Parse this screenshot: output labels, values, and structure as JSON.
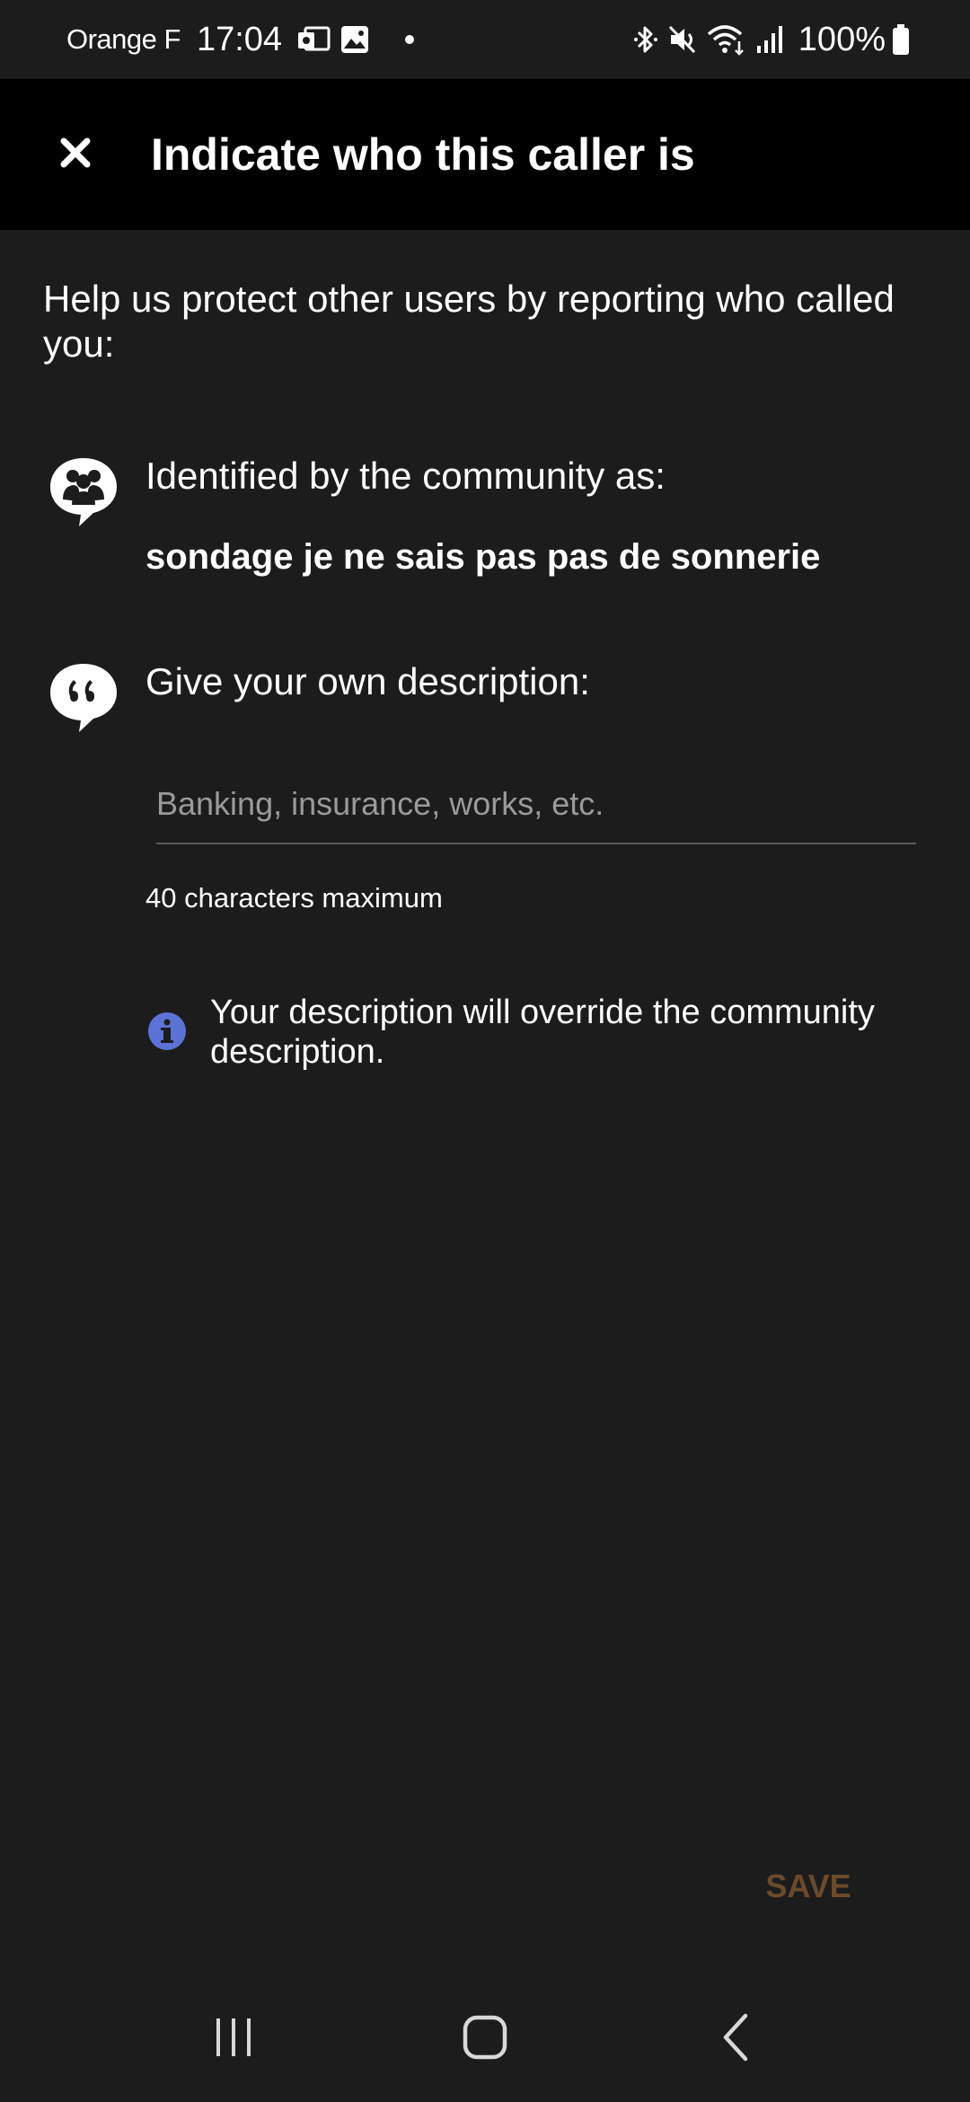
{
  "status_bar": {
    "carrier": "Orange F",
    "time": "17:04",
    "battery": "100%",
    "icons_left": [
      "outlook-icon",
      "gallery-icon",
      "dot-icon"
    ],
    "icons_right": [
      "bluetooth-icon",
      "mute-icon",
      "wifi-icon",
      "signal-icon",
      "battery-icon"
    ]
  },
  "app_bar": {
    "close_icon": "close-icon",
    "title": "Indicate who this caller is"
  },
  "content": {
    "intro": "Help us protect other users by reporting who called you:",
    "community": {
      "icon": "community-icon",
      "label": "Identified by the community as:",
      "value": "sondage je ne sais pas pas de sonnerie"
    },
    "own_description": {
      "icon": "quote-icon",
      "label": "Give your own description:",
      "placeholder": "Banking, insurance, works, etc.",
      "value": "",
      "limit_text": "40 characters maximum"
    },
    "info": {
      "icon": "info-icon",
      "text": "Your description will override the community description."
    }
  },
  "actions": {
    "save_label": "SAVE"
  },
  "nav_bar": {
    "items": [
      "recents-icon",
      "home-icon",
      "back-icon"
    ]
  },
  "colors": {
    "background": "#1c1c1c",
    "app_bar": "#000000",
    "info_accent": "#5b73d6",
    "save_disabled": "#6b4a2c",
    "divider": "#5a5a5a"
  }
}
